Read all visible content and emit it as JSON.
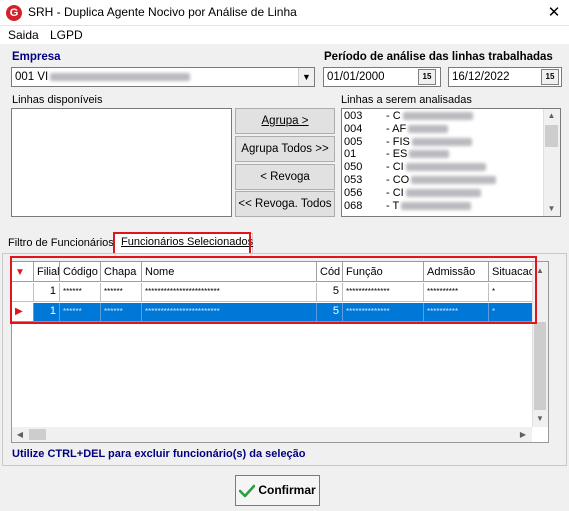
{
  "window": {
    "title": "SRH - Duplica Agente Nocivo por Análise de Linha",
    "app_icon": "G"
  },
  "menu": {
    "items": [
      "Saida",
      "LGPD"
    ]
  },
  "empresa": {
    "label": "Empresa",
    "value_prefix": "001 VI"
  },
  "periodo": {
    "label": "Período de análise das linhas trabalhadas",
    "start": "01/01/2000",
    "end": "16/12/2022",
    "cal_glyph": "15"
  },
  "linhas_disponiveis": {
    "label": "Linhas disponíveis"
  },
  "buttons": {
    "agrupa": "Agrupa >",
    "agrupa_todos": "Agrupa Todos >>",
    "revoga": "< Revoga",
    "revoga_todos": "<< Revoga. Todos"
  },
  "linhas_analisadas": {
    "label": "Linhas a serem analisadas",
    "items": [
      {
        "code": "003",
        "prefix": "- C"
      },
      {
        "code": "004",
        "prefix": "- AF"
      },
      {
        "code": "005",
        "prefix": "- FIS"
      },
      {
        "code": "01",
        "prefix": "- ES"
      },
      {
        "code": "050",
        "prefix": "- CI"
      },
      {
        "code": "053",
        "prefix": "- CO"
      },
      {
        "code": "056",
        "prefix": "- CI"
      },
      {
        "code": "068",
        "prefix": "- T"
      }
    ]
  },
  "tabs": [
    "Filtro de Funcionários",
    "Funcionários Selecionados"
  ],
  "grid": {
    "headers": [
      "Filial",
      "Código",
      "Chapa",
      "Nome",
      "Cód",
      "Função",
      "Admissão",
      "Situacao"
    ],
    "rows": [
      {
        "filial": "1",
        "codigo": "******",
        "chapa": "******",
        "nome": "************************",
        "cod": "5",
        "funcao": "**************",
        "admissao": "**********",
        "situacao": "*"
      },
      {
        "filial": "1",
        "codigo": "******",
        "chapa": "******",
        "nome": "************************",
        "cod": "5",
        "funcao": "**************",
        "admissao": "**********",
        "situacao": "*"
      }
    ]
  },
  "hint": "Utilize CTRL+DEL para excluir funcionário(s) da seleção",
  "confirm": {
    "label": "Confirmar"
  },
  "colors": {
    "accent_red": "#e0141b",
    "selection_blue": "#0078d7",
    "label_navy": "#000080",
    "confirm_check": "#2e9e3f"
  }
}
